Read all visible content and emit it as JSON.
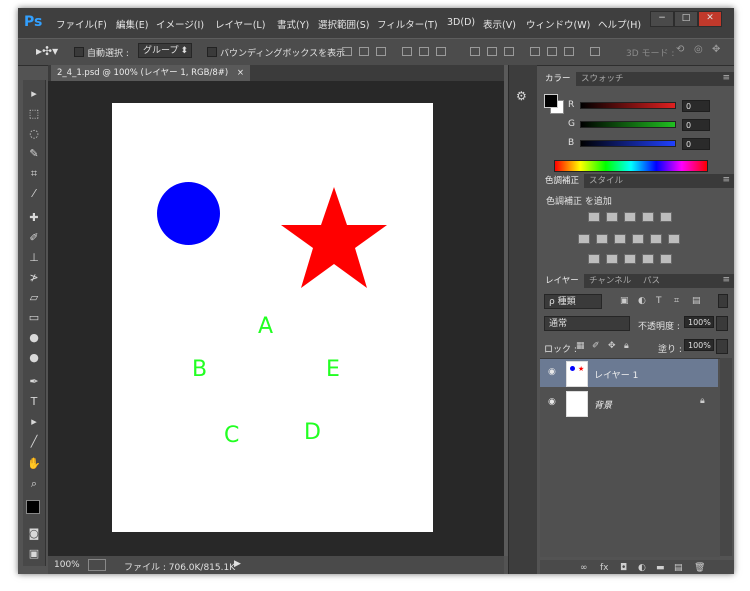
{
  "app": {
    "logo": "Ps"
  },
  "menu": [
    "ファイル(F)",
    "編集(E)",
    "イメージ(I)",
    "レイヤー(L)",
    "書式(Y)",
    "選択範囲(S)",
    "フィルター(T)",
    "3D(D)",
    "表示(V)",
    "ウィンドウ(W)",
    "ヘルプ(H)"
  ],
  "window_controls": {
    "minimize": "−",
    "maximize": "□",
    "close": "✕"
  },
  "options": {
    "auto_select_label": "自動選択 :",
    "group_value": "グループ",
    "bbox_label": "バウンディングボックスを表示",
    "mode3d_label": "3D モード :"
  },
  "document_tab": {
    "title": "2_4_1.psd @ 100% (レイヤー 1, RGB/8#)",
    "close": "×"
  },
  "canvas": {
    "letters": [
      "A",
      "B",
      "C",
      "D",
      "E"
    ],
    "circle_color": "#0000ff",
    "star_color": "#ff0000",
    "letter_color": "#22ff22"
  },
  "status": {
    "zoom": "100%",
    "file_info": "ファイル : 706.0K/815.1K"
  },
  "color_panel": {
    "tabs": [
      "カラー",
      "スウォッチ"
    ],
    "channels": [
      {
        "label": "R",
        "value": "0",
        "color": "#e02020"
      },
      {
        "label": "G",
        "value": "0",
        "color": "#20c020"
      },
      {
        "label": "B",
        "value": "0",
        "color": "#2040ff"
      }
    ]
  },
  "adjust_panel": {
    "tabs": [
      "色調補正",
      "スタイル"
    ],
    "title": "色調補正 を追加"
  },
  "layers_panel": {
    "tabs": [
      "レイヤー",
      "チャンネル",
      "パス"
    ],
    "filter_label": "ρ 種類",
    "blend_mode": "通常",
    "opacity_label": "不透明度 :",
    "opacity_value": "100%",
    "lock_label": "ロック :",
    "fill_label": "塗り :",
    "fill_value": "100%",
    "layers": [
      {
        "name": "レイヤー 1",
        "selected": true
      },
      {
        "name": "背景",
        "selected": false,
        "locked": true
      }
    ]
  },
  "colors": {
    "accent_blue": "#32a0ff",
    "selected_layer": "#6b7a93"
  }
}
